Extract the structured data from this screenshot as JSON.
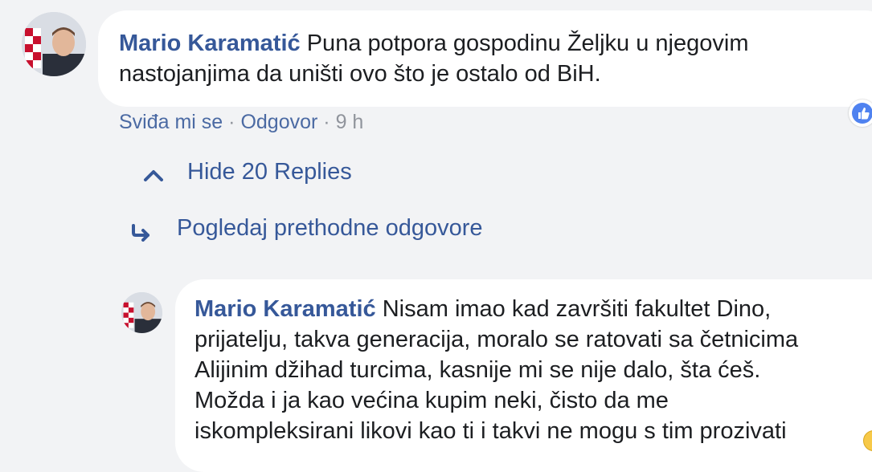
{
  "comment": {
    "author": "Mario Karamatić",
    "text_line1": "Puna potpora gospodinu Željku u njegovim",
    "text_line2": "nastojanjima da uništi ovo što je ostalo od BiH.",
    "actions": {
      "like": "Sviđa mi se",
      "separator": "·",
      "reply": "Odgovor",
      "time": "9 h"
    },
    "reaction_icon": "like-reaction-icon"
  },
  "replies": {
    "hide_label": "Hide 20 Replies",
    "previous_label": "Pogledaj prethodne odgovore"
  },
  "reply": {
    "author": "Mario Karamatić",
    "line1": "Nisam imao kad završiti fakultet Dino,",
    "line2": "prijatelju, takva generacija, moralo se ratovati sa četnicima",
    "line3": "Alijinim džihad turcima, kasnije mi se nije dalo, šta ćeš.",
    "line4": "Možda i ja kao većina kupim neki, čisto da me",
    "line5": "iskompleksirani likovi kao ti i takvi ne mogu s tim prozivati",
    "trailing_icon": "emoji-icon"
  },
  "colors": {
    "background": "#f2f3f5",
    "bubble": "#ffffff",
    "name": "#365899",
    "link": "#365899",
    "muted": "#90949c"
  }
}
